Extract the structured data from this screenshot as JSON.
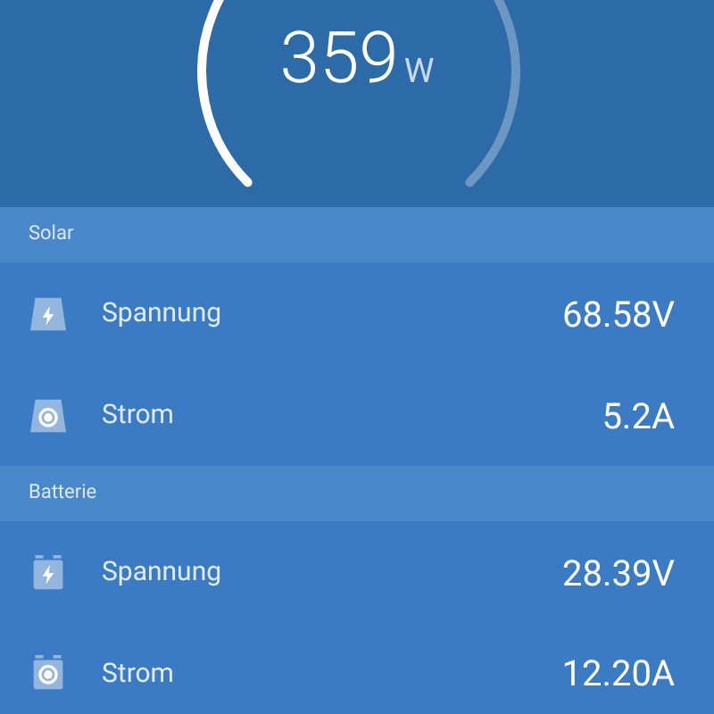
{
  "gauge": {
    "value": "359",
    "unit": "W"
  },
  "sections": [
    {
      "title": "Solar",
      "kind": "solar",
      "rows": [
        {
          "kind": "voltage",
          "label": "Spannung",
          "value": "68.58V"
        },
        {
          "kind": "current",
          "label": "Strom",
          "value": "5.2A"
        }
      ]
    },
    {
      "title": "Batterie",
      "kind": "battery",
      "rows": [
        {
          "kind": "voltage",
          "label": "Spannung",
          "value": "28.39V"
        },
        {
          "kind": "current",
          "label": "Strom",
          "value": "12.20A"
        }
      ]
    }
  ]
}
